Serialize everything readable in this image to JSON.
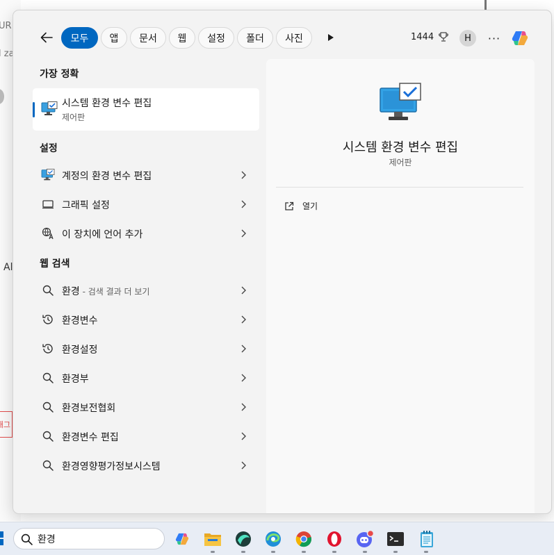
{
  "background": {
    "fragments": [
      "UR",
      "l za",
      "Al",
      "태그"
    ]
  },
  "topbar": {
    "filters": [
      {
        "label": "모두",
        "active": true
      },
      {
        "label": "앱",
        "active": false
      },
      {
        "label": "문서",
        "active": false
      },
      {
        "label": "웹",
        "active": false
      },
      {
        "label": "설정",
        "active": false
      },
      {
        "label": "폴더",
        "active": false
      },
      {
        "label": "사진",
        "active": false
      }
    ],
    "rewards_points": "1444",
    "avatar_initial": "H",
    "more_label": "···"
  },
  "results": {
    "best_match_heading": "가장 정확",
    "best_match": {
      "title": "시스템 환경 변수 편집",
      "subtitle": "제어판"
    },
    "settings_heading": "설정",
    "settings_items": [
      {
        "label": "계정의 환경 변수 편집",
        "icon": "monitor-check-icon"
      },
      {
        "label": "그래픽 설정",
        "icon": "display-icon"
      },
      {
        "label": "이 장치에 언어 추가",
        "icon": "language-icon"
      }
    ],
    "web_heading": "웹 검색",
    "web_items": [
      {
        "label": "환경",
        "suffix": " - 검색 결과 더 보기",
        "icon": "search-icon"
      },
      {
        "label": "환경변수",
        "suffix": "",
        "icon": "history-icon"
      },
      {
        "label": "환경설정",
        "suffix": "",
        "icon": "history-icon"
      },
      {
        "label": "환경부",
        "suffix": "",
        "icon": "search-icon"
      },
      {
        "label": "환경보전협회",
        "suffix": "",
        "icon": "search-icon"
      },
      {
        "label": "환경변수 편집",
        "suffix": "",
        "icon": "search-icon"
      },
      {
        "label": "환경영향평가정보시스템",
        "suffix": "",
        "icon": "search-icon"
      }
    ]
  },
  "preview": {
    "title": "시스템 환경 변수 편집",
    "subtitle": "제어판",
    "action_open": "열기"
  },
  "taskbar": {
    "search_value": "환경",
    "apps": [
      "copilot-icon",
      "file-explorer-icon",
      "app-icon",
      "edge-icon",
      "chrome-icon",
      "opera-icon",
      "discord-icon",
      "terminal-icon",
      "notepad-icon"
    ]
  },
  "colors": {
    "accent": "#0067c0",
    "flyout_bg": "#f3f3f3",
    "taskbar_bg": "#e8edf5"
  }
}
